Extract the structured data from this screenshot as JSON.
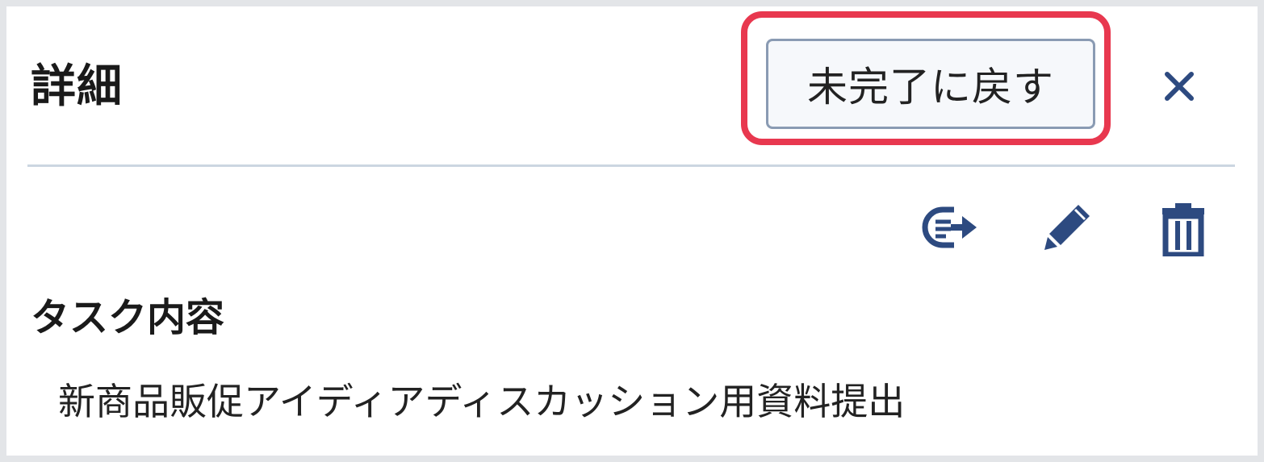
{
  "header": {
    "title": "詳細",
    "revert_label": "未完了に戻す"
  },
  "toolbar": {
    "icons": [
      "move-icon",
      "edit-icon",
      "delete-icon"
    ]
  },
  "task": {
    "label": "タスク内容",
    "content": "新商品販促アイディアディスカッション用資料提出"
  },
  "colors": {
    "accent": "#2d4a80",
    "highlight": "#e8384f",
    "divider": "#ccd6e1",
    "button_bg": "#f6f8fb",
    "button_border": "#8a9bb3"
  }
}
